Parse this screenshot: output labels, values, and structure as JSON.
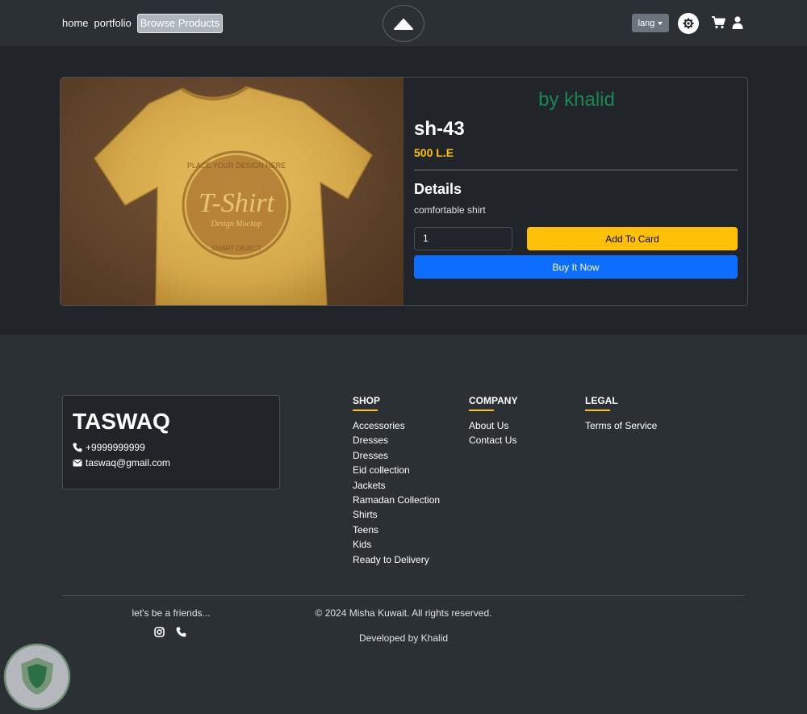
{
  "nav": {
    "links": [
      "home",
      "portfolio",
      "Browse Products"
    ],
    "lang_label": "lang",
    "icons": [
      "cloud-logo-icon",
      "gear-icon",
      "cart-icon",
      "user-icon"
    ]
  },
  "product": {
    "author": "by khalid",
    "name": "sh-43",
    "price": "500 L.E",
    "details_heading": "Details",
    "details_text": "comfortable shirt",
    "quantity": "1",
    "add_to_cart_label": "Add To Card",
    "buy_now_label": "Buy It Now",
    "image_alt_text": [
      "PLACE YOUR DESIGN HERE",
      "T-Shirt",
      "Design Mockup",
      "SMART OBJECT"
    ]
  },
  "footer": {
    "brand": "TASWAQ",
    "phone": "+9999999999",
    "email": "taswaq@gmail.com",
    "columns": [
      {
        "title": "SHOP",
        "links": [
          "Accessories",
          "Dresses",
          "Dresses",
          "Eid collection",
          "Jackets",
          "Ramadan Collection",
          "Shirts",
          "Teens",
          "Kids",
          "Ready to Delivery"
        ]
      },
      {
        "title": "COMPANY",
        "links": [
          "About Us",
          "Contact Us"
        ]
      },
      {
        "title": "LEGAL",
        "links": [
          "Terms of Service"
        ]
      }
    ],
    "friends_text": "let's be a friends...",
    "copyright": "© 2024 Misha Kuwait. All rights reserved.",
    "developed_by": "Developed by Khalid",
    "social_icons": [
      "instagram-icon",
      "phone-icon"
    ]
  },
  "colors": {
    "page_bg": "#2b3035",
    "section_bg": "#212529",
    "author_green": "#198754",
    "price_yellow": "#ffc107",
    "primary_blue": "#0d6efd"
  }
}
